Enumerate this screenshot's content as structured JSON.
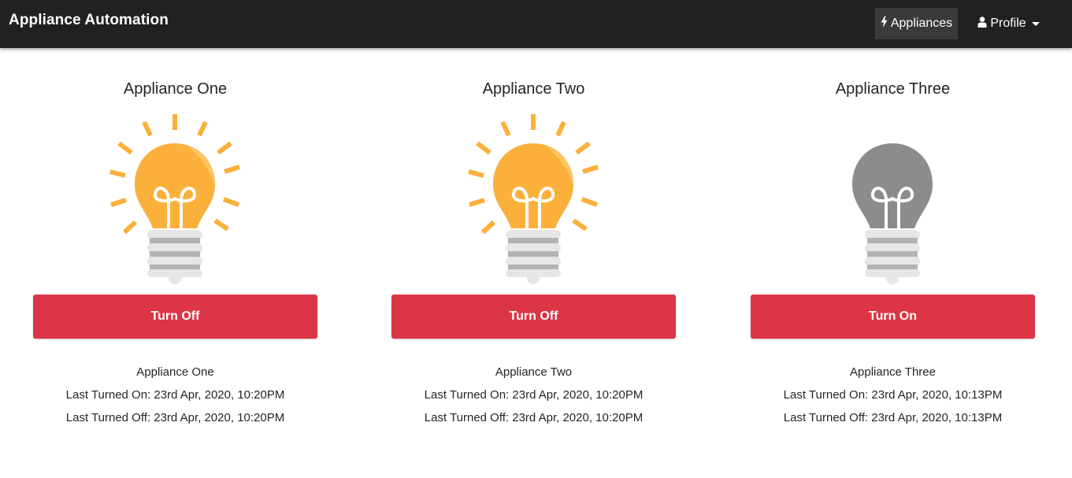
{
  "navbar": {
    "brand": "Appliance Automation",
    "appliances_label": "Appliances",
    "appliances_icon": "bolt-icon",
    "profile_label": "Profile",
    "profile_icon": "user-icon"
  },
  "colors": {
    "navbar_bg": "#212121",
    "active_nav_bg": "#3a3a3a",
    "button_bg": "#dc3545",
    "bulb_on": "#fbb03b",
    "bulb_off": "#8c8c8c",
    "rays": "#fbb03b"
  },
  "appliances": [
    {
      "title": "Appliance One",
      "state": "on",
      "button_label": "Turn Off",
      "name": "Appliance One",
      "last_on": "Last Turned On: 23rd Apr, 2020, 10:20PM",
      "last_off": "Last Turned Off: 23rd Apr, 2020, 10:20PM"
    },
    {
      "title": "Appliance Two",
      "state": "on",
      "button_label": "Turn Off",
      "name": "Appliance Two",
      "last_on": "Last Turned On: 23rd Apr, 2020, 10:20PM",
      "last_off": "Last Turned Off: 23rd Apr, 2020, 10:20PM"
    },
    {
      "title": "Appliance Three",
      "state": "off",
      "button_label": "Turn On",
      "name": "Appliance Three",
      "last_on": "Last Turned On: 23rd Apr, 2020, 10:13PM",
      "last_off": "Last Turned Off: 23rd Apr, 2020, 10:13PM"
    }
  ]
}
